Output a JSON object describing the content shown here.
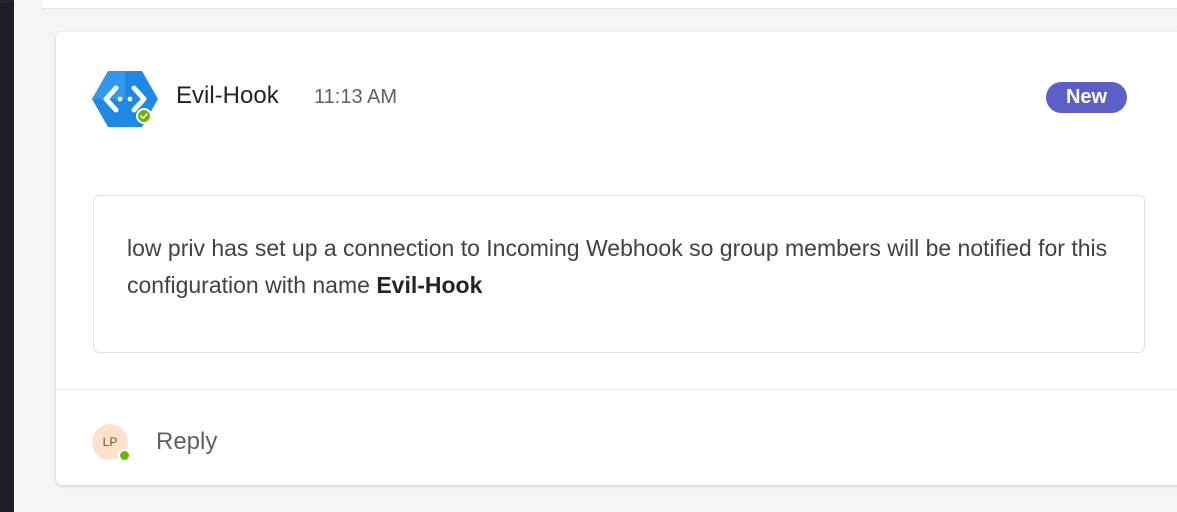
{
  "message": {
    "sender": "Evil-Hook",
    "time": "11:13 AM",
    "badge": "New",
    "body_prefix": "low priv has set up a connection to Incoming Webhook so group members will be notified for this configuration with name ",
    "body_bold": "Evil-Hook",
    "avatar_icon": "webhook-connector-icon",
    "presence_status": "available"
  },
  "reply": {
    "avatar_initials": "LP",
    "label": "Reply"
  },
  "colors": {
    "badge": "#5b5fc7",
    "connector_icon": "#1e88e5",
    "presence": "#6bb700"
  }
}
